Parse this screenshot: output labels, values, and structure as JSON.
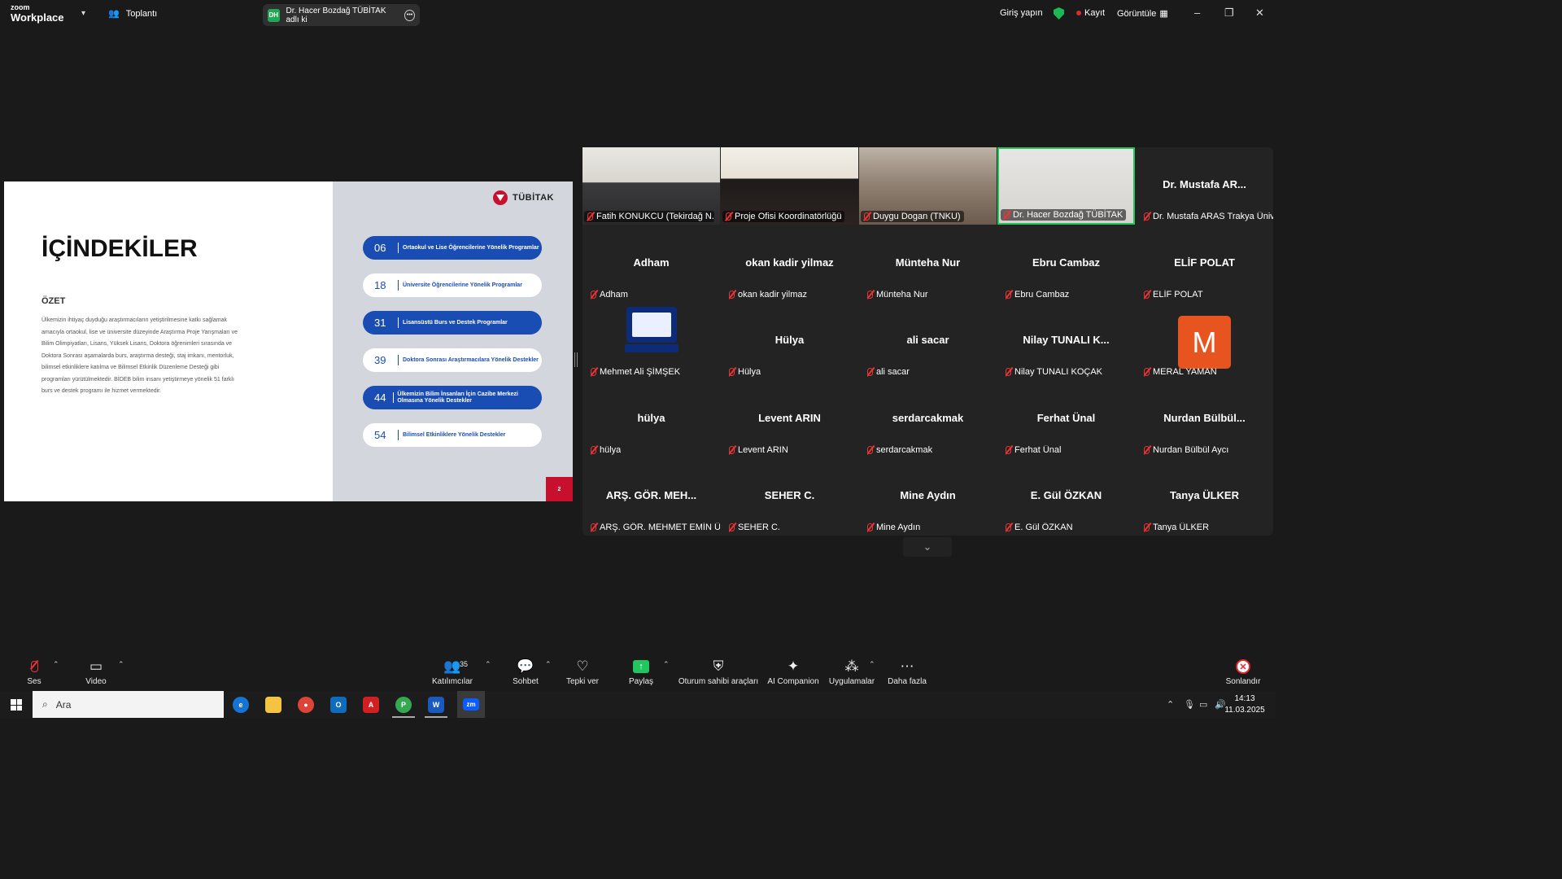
{
  "app": {
    "brand_top": "zoom",
    "brand_bottom": "Workplace",
    "meeting_label": "Toplantı",
    "tab_label": "Dr. Hacer Bozdağ TÜBİTAK adlı ki",
    "tab_initials": "DH",
    "signin": "Giriş yapın",
    "record": "Kayıt",
    "view": "Görüntüle",
    "win_min": "–",
    "win_max": "❐",
    "win_close": "✕"
  },
  "slide": {
    "title": "İÇİNDEKİLER",
    "subtitle": "ÖZET",
    "body": "Ülkemizin ihtiyaç duyduğu araştırmacıların yetiştirilmesine katkı sağlamak amacıyla ortaokul, lise ve üniversite düzeyinde Araştırma Proje Yarışmaları ve Bilim Olimpiyatları, Lisans, Yüksek Lisans, Doktora öğrenimleri sırasında ve Doktora Sonrası aşamalarda burs, araştırma desteği, staj imkanı, mentorluk, bilimsel etkinliklere katılma ve Bilimsel Etkinlik Düzenleme Desteği gibi programları yürütülmektedir. BİDEB bilim insanı yetiştirmeye yönelik 51 farklı burs ve destek programı ile hizmet vermektedir.",
    "logo_text": "TÜBİTAK",
    "page": "2",
    "items": [
      {
        "num": "06",
        "text": "Ortaokul ve Lise Öğrencilerine Yönelik Programlar",
        "style": "blue"
      },
      {
        "num": "18",
        "text": "Üniversite Öğrencilerine Yönelik Programlar",
        "style": "white"
      },
      {
        "num": "31",
        "text": "Lisansüstü Burs ve Destek Programlar",
        "style": "blue"
      },
      {
        "num": "39",
        "text": "Doktora Sonrası Araştırmacılara Yönelik Destekler",
        "style": "white"
      },
      {
        "num": "44",
        "text": "Ülkemizin Bilim İnsanları İçin Cazibe Merkezi Olmasına Yönelik Destekler",
        "style": "blue"
      },
      {
        "num": "54",
        "text": "Bilimsel Etkinliklere Yönelik Destekler",
        "style": "white"
      }
    ]
  },
  "gallery": [
    {
      "label": "Fatih KONUKCU (Tekirdağ N. ...",
      "type": "video"
    },
    {
      "label": "Proje Ofisi Koordinatörlüğü",
      "type": "video"
    },
    {
      "label": "Duygu Dogan (TNKU)",
      "type": "video"
    },
    {
      "label": "Dr. Hacer Bozdağ TÜBİTAK",
      "type": "video",
      "active": true
    },
    {
      "big": "Dr. Mustafa AR...",
      "label": "Dr. Mustafa ARAS Trakya Üniv..."
    },
    {
      "big": "Adham",
      "label": "Adham"
    },
    {
      "big": "okan kadir yilmaz",
      "label": "okan kadir yilmaz"
    },
    {
      "big": "Münteha Nur",
      "label": "Münteha Nur"
    },
    {
      "big": "Ebru Cambaz",
      "label": "Ebru Cambaz"
    },
    {
      "big": "ELİF POLAT",
      "label": "ELİF POLAT"
    },
    {
      "label": "Mehmet Ali ŞİMŞEK",
      "type": "pc"
    },
    {
      "big": "Hülya",
      "label": "Hülya"
    },
    {
      "big": "ali sacar",
      "label": "ali sacar"
    },
    {
      "big": "Nilay TUNALI K...",
      "label": "Nilay TUNALI KOÇAK"
    },
    {
      "label": "MERAL YAMAN",
      "type": "letter",
      "letter": "M"
    },
    {
      "big": "hülya",
      "label": "hülya"
    },
    {
      "big": "Levent ARIN",
      "label": "Levent ARIN"
    },
    {
      "big": "serdarcakmak",
      "label": "serdarcakmak"
    },
    {
      "big": "Ferhat Ünal",
      "label": "Ferhat Ünal"
    },
    {
      "big": "Nurdan  Bülbül...",
      "label": "Nurdan Bülbül Aycı"
    },
    {
      "big": "ARŞ. GÖR. MEH...",
      "label": "ARŞ. GÖR. MEHMET EMİN Ü..."
    },
    {
      "big": "SEHER C.",
      "label": "SEHER C."
    },
    {
      "big": "Mine Aydın",
      "label": "Mine Aydın"
    },
    {
      "big": "E. Gül ÖZKAN",
      "label": "E. Gül ÖZKAN"
    },
    {
      "big": "Tanya ÜLKER",
      "label": "Tanya ÜLKER"
    }
  ],
  "toolbar": {
    "audio": "Ses",
    "video": "Video",
    "participants": "Katılımcılar",
    "participant_count": "35",
    "chat": "Sohbet",
    "react": "Tepki ver",
    "share": "Paylaş",
    "host_tools": "Oturum sahibi araçları",
    "companion": "AI Companion",
    "apps": "Uygulamalar",
    "more": "Daha fazla",
    "end": "Sonlandır"
  },
  "taskbar": {
    "search_placeholder": "Ara",
    "time": "14:13",
    "date": "11.03.2025"
  },
  "colors": {
    "zoom_blue": "#0b5cff",
    "tubitak_red": "#c8102e",
    "slide_blue": "#1a4db3",
    "active_green": "#23c55e"
  }
}
